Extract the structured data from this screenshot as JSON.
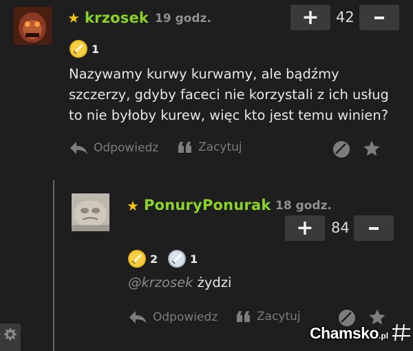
{
  "comment1": {
    "username": "krzosek",
    "time": "19 godz.",
    "score": "42",
    "plus_label": "+",
    "minus_label": "−",
    "badge_gold_count": "1",
    "text": "Nazywamy kurwy kurwamy, ale bądźmy szczerzy, gdyby faceci nie korzystali z ich usług to nie byłoby kurew, więc kto jest temu winien?",
    "reply_label": "Odpowiedz",
    "quote_label": "Zacytuj"
  },
  "comment2": {
    "username": "PonuryPonurak",
    "time": "18 godz.",
    "score": "84",
    "plus_label": "+",
    "minus_label": "−",
    "badge_gold_count": "2",
    "badge_silver_count": "1",
    "mention": "@krzosek",
    "text": "żydzi",
    "reply_label": "Odpowiedz",
    "quote_label": "Zacytuj"
  },
  "watermark": {
    "brand": "Chamsko",
    "suffix": ".pl"
  },
  "colors": {
    "background": "#1e1e1e",
    "username": "#8bd32a",
    "star": "#f2c40f",
    "muted": "#7d7d7d"
  }
}
